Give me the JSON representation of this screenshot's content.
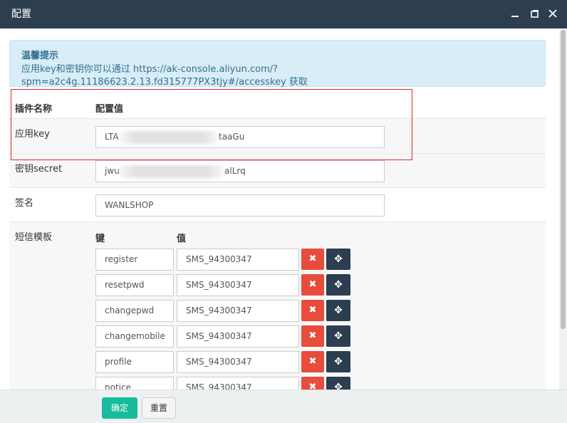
{
  "window": {
    "title": "配置",
    "minimize_icon": "minimize-icon",
    "maximize_icon": "maximize-icon",
    "close_icon": "close-icon"
  },
  "notice": {
    "title": "温馨提示",
    "body": "应用key和密钥你可以通过 https://ak-console.aliyun.com/?spm=a2c4g.11186623.2.13.fd315777PX3tjy#/accesskey 获取"
  },
  "table": {
    "col_name": "插件名称",
    "col_value": "配置值"
  },
  "fields": {
    "app_key": {
      "label": "应用key",
      "prefix": "LTA",
      "suffix": "taaGu"
    },
    "secret": {
      "label": "密钥secret",
      "prefix": "jwu",
      "suffix": "alLrq"
    },
    "sign": {
      "label": "签名",
      "value": "WANLSHOP"
    }
  },
  "templates": {
    "label": "短信模板",
    "key_header": "键",
    "value_header": "值",
    "delete_icon": "✖",
    "move_icon": "✥",
    "rows": [
      {
        "key": "register",
        "value": "SMS_94300347"
      },
      {
        "key": "resetpwd",
        "value": "SMS_94300347"
      },
      {
        "key": "changepwd",
        "value": "SMS_94300347"
      },
      {
        "key": "changemobile",
        "value": "SMS_94300347"
      },
      {
        "key": "profile",
        "value": "SMS_94300347"
      },
      {
        "key": "notice",
        "value": "SMS_94300347"
      }
    ]
  },
  "footer": {
    "ok_label": "确定",
    "reset_label": "重置"
  },
  "colors": {
    "titlebar": "#2c3e50",
    "alert_bg": "#d9edf7",
    "danger": "#e74c3c",
    "success": "#18bc9c",
    "highlight_border": "#e0252b"
  }
}
